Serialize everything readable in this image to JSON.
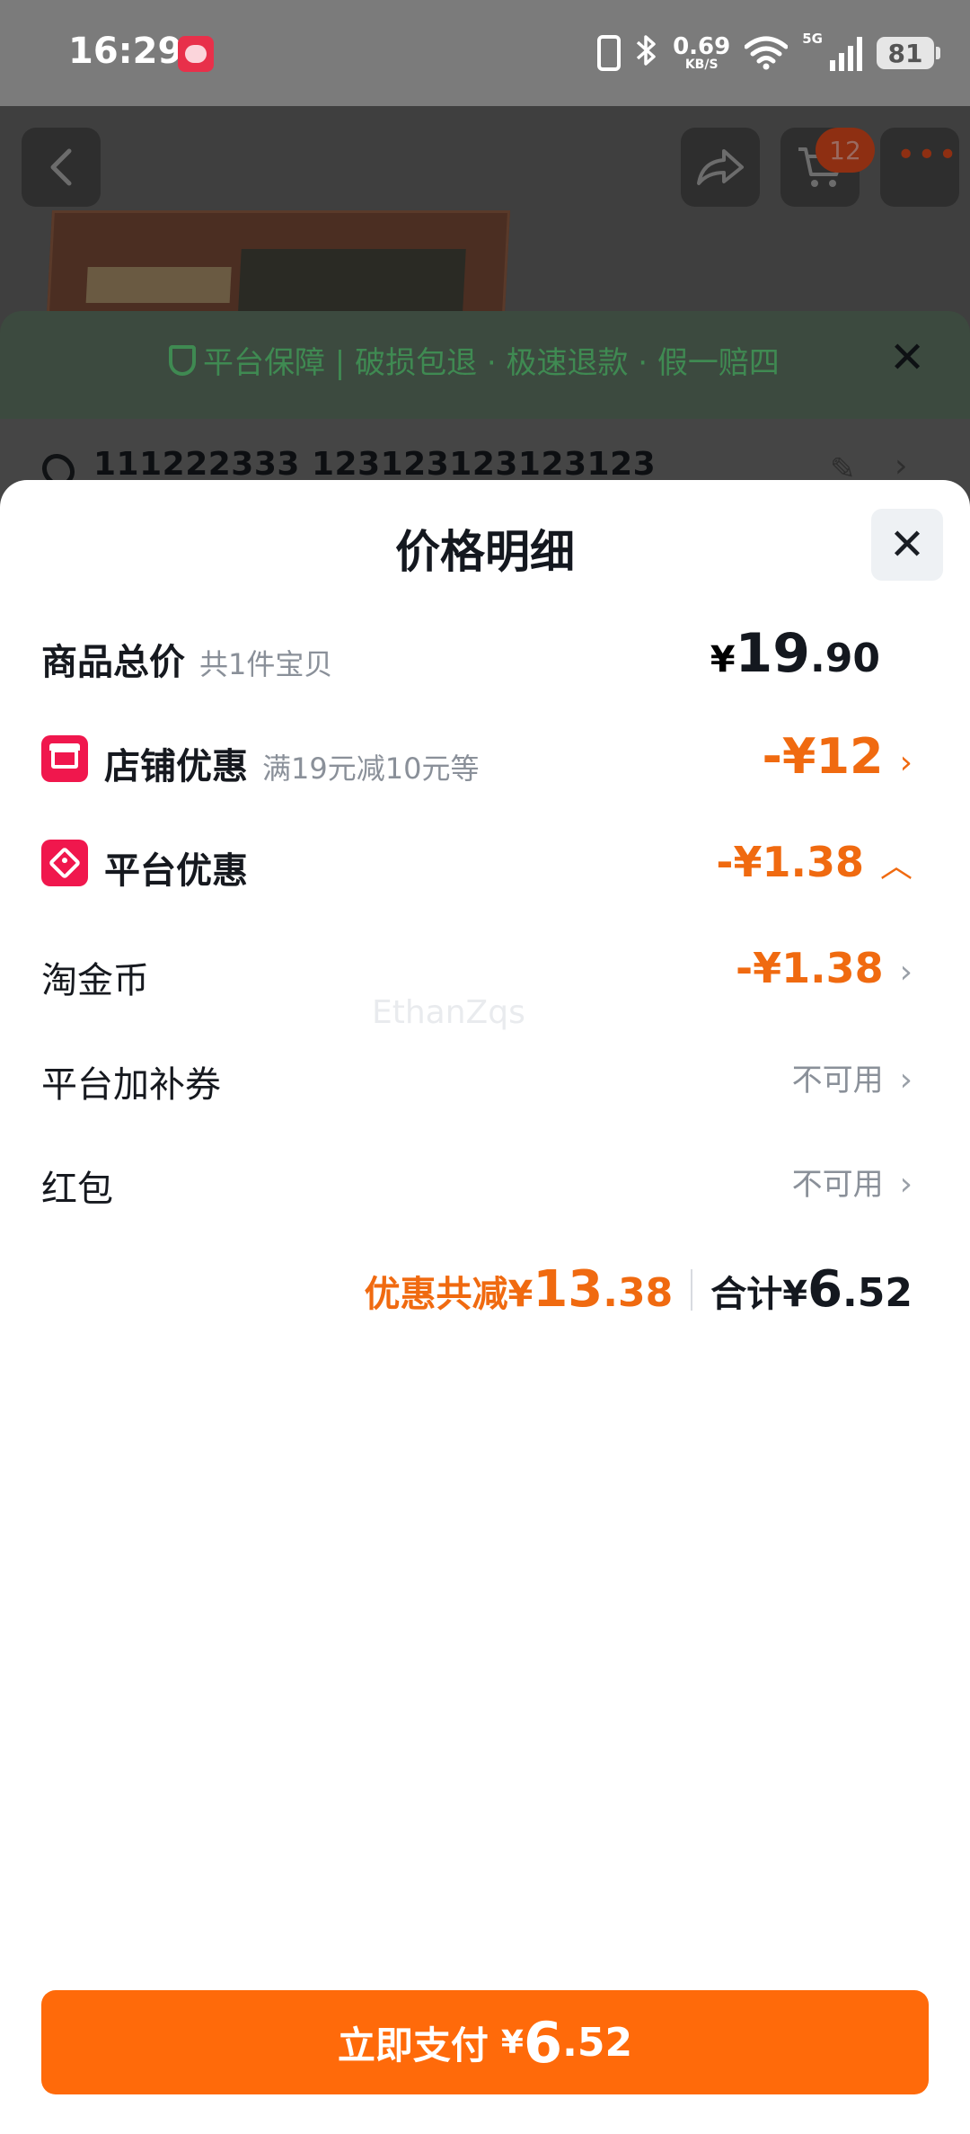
{
  "status_bar": {
    "time": "16:29",
    "net_speed": "0.69",
    "net_speed_unit": "KB/S",
    "network_type": "5G",
    "battery": "81"
  },
  "background_page": {
    "cart_count": "12",
    "guarantee_text": "平台保障 | 破损包退 · 极速退款 · 假一赔四",
    "address": "111222333 123123123123123"
  },
  "sheet": {
    "title": "价格明细",
    "rows": {
      "total": {
        "label": "商品总价",
        "sub": "共1件宝贝",
        "currency": "¥",
        "int": "19",
        "dec": ".90"
      },
      "shop": {
        "label": "店铺优惠",
        "sub": "满19元减10元等",
        "amount": "-¥12"
      },
      "platform": {
        "label": "平台优惠",
        "amount": "-¥1.38"
      },
      "coin": {
        "label": "淘金币",
        "amount": "-¥1.38"
      },
      "coupon": {
        "label": "平台加补券",
        "status": "不可用"
      },
      "redpack": {
        "label": "红包",
        "status": "不可用"
      }
    },
    "watermark": "EthanZqs",
    "summary": {
      "save_label": "优惠共减",
      "save_currency": "¥",
      "save_int": "13",
      "save_dec": ".38",
      "total_label": "合计",
      "total_currency": "¥",
      "total_int": "6",
      "total_dec": ".52"
    },
    "pay_button": {
      "label": "立即支付",
      "currency": "¥",
      "int": "6",
      "dec": ".52"
    }
  },
  "colors": {
    "accent_orange": "#ff6a0a",
    "discount_orange": "#f06a10",
    "badge_red": "#f0174d",
    "text_dark": "#14181f",
    "text_gray": "#8a9099"
  }
}
